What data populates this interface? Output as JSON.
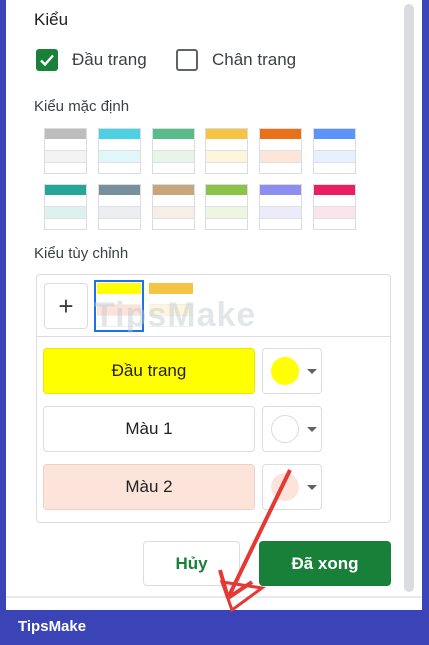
{
  "section": {
    "title": "Kiểu"
  },
  "checks": [
    {
      "label": "Đầu trang",
      "checked": true
    },
    {
      "label": "Chân trang",
      "checked": false
    }
  ],
  "presets": {
    "title": "Kiểu mặc định",
    "colors": [
      "#bdbdbd",
      "#4dd0e1",
      "#57bb8a",
      "#f6c445",
      "#e8711a",
      "#5b95f9",
      "#26a69a",
      "#78909c",
      "#c9a57e",
      "#8bc34a",
      "#8e8ef0",
      "#e91e63"
    ],
    "tints": [
      "#f3f3f3",
      "#e0f7fa",
      "#e6f4ea",
      "#fef6dc",
      "#fde6d9",
      "#e8f0fe",
      "#ddf2ef",
      "#eceff1",
      "#f7efe6",
      "#eef6e2",
      "#ebebfc",
      "#fce4ec"
    ]
  },
  "custom": {
    "title": "Kiểu tùy chỉnh",
    "add_symbol": "+",
    "thumbs": [
      {
        "band": "#ffff00",
        "tint": "#fde2d8",
        "selected": true
      },
      {
        "band": "#f6c445",
        "tint": "#fef6dc",
        "selected": false
      }
    ],
    "rows": [
      {
        "label": "Đầu trang",
        "fill": "#ffff00",
        "swatch": "#ffff00"
      },
      {
        "label": "Màu 1",
        "fill": "#ffffff",
        "swatch": "#ffffff"
      },
      {
        "label": "Màu 2",
        "fill": "#fde4da",
        "swatch": "#fde4da"
      }
    ]
  },
  "buttons": {
    "cancel": "Hủy",
    "done": "Đã xong"
  },
  "watermark": "TipsMake",
  "footer": {
    "brand": "TipsMake"
  },
  "colors": {
    "accent": "#188038",
    "frame": "#3a44b6"
  }
}
